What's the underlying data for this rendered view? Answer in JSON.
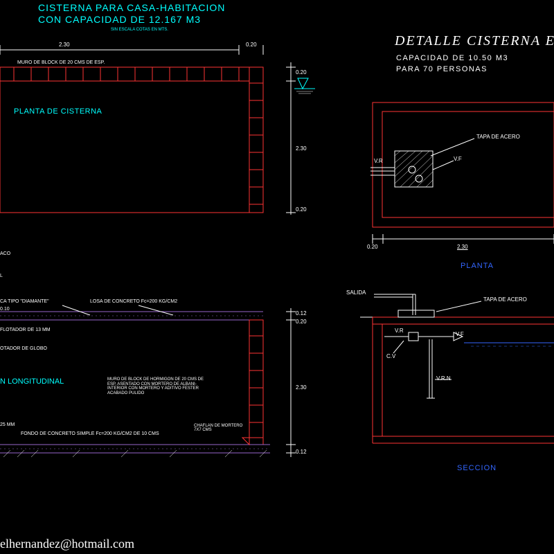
{
  "left": {
    "title1": "CISTERNA PARA CASA-HABITACION",
    "title2": "CON CAPACIDAD DE 12.167 M3",
    "scale_note": "SIN ESCALA COTAS EN MTS.",
    "plan_label": "PLANTA DE CISTERNA",
    "section_label": "N LONGITUDINAL",
    "dims": {
      "d230_top": "2.30",
      "d020_tr": "0.20",
      "d020_tr2": "0.20",
      "d230_right": "2.30",
      "d020_br": "0.20",
      "d012_t": "0.12",
      "d020_s": "0.20",
      "d230_s": "2.30",
      "d012_b": "0.12",
      "d010": "0.10",
      "d025": "25 MM"
    },
    "notes": {
      "muro_top": "MURO DE BLOCK DE 20 CMS DE ESP.",
      "diamante": "CA TIPO \"DIAMANTE\"",
      "losa": "LOSA DE CONCRETO Fc=200 KG/CM2",
      "flotador13": "FLOTADOR DE 13 MM",
      "flotador_globo": "OTADOR DE GLOBO",
      "muro_block": "MURO DE BLOCK DE HORMIGON DE 20 CMS DE ESP. ASENTADO CON MORTERO DE ALBANI- INTERIOR CON MORTERO Y ADITIVO FESTER ACABADO PULIDO",
      "chaflan": "CHAFLAN DE MORTERO 7X7 CMS",
      "fondo": "FONDO DE CONCRETO SIMPLE Fc=200 KG/CM2 DE 10 CMS",
      "aco": "ACO",
      "l_partial": "L"
    }
  },
  "right": {
    "heading": "DETALLE CISTERNA E",
    "sub1": "CAPACIDAD DE 10.50 M3",
    "sub2": "PARA 70 PERSONAS",
    "plan_label": "PLANTA",
    "section_label": "SECCION",
    "labels": {
      "tapa": "TAPA DE ACERO",
      "tapa2": "TAPA DE ACERO",
      "vr": "V.R",
      "vf": "V.F",
      "vf2": "V.F",
      "vr2": "V.R",
      "cv": "C.V",
      "vrn": "V.R.N",
      "salida": "SALIDA"
    },
    "dims": {
      "d020": "0.20",
      "d230": "2.30"
    }
  },
  "footer": {
    "email": "elhernandez@hotmail.com"
  }
}
